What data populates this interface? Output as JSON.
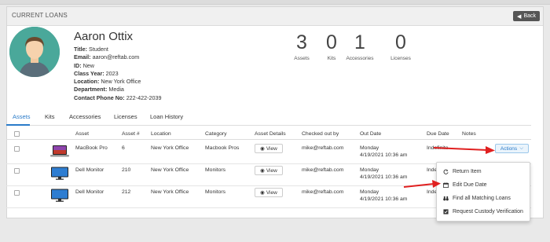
{
  "panel": {
    "title": "CURRENT LOANS",
    "back_label": "Back"
  },
  "profile": {
    "name": "Aaron Ottix",
    "fields": [
      {
        "label": "Title:",
        "value": "Student"
      },
      {
        "label": "Email:",
        "value": "aaron@reftab.com"
      },
      {
        "label": "ID:",
        "value": "New"
      },
      {
        "label": "Class Year:",
        "value": "2023"
      },
      {
        "label": "Location:",
        "value": "New York Office"
      },
      {
        "label": "Department:",
        "value": "Media"
      },
      {
        "label": "Contact Phone No:",
        "value": "222-422-2039"
      }
    ]
  },
  "stats": [
    {
      "value": "3",
      "label": "Assets"
    },
    {
      "value": "0",
      "label": "Kits"
    },
    {
      "value": "1",
      "label": "Accessories"
    },
    {
      "value": "0",
      "label": "Licenses"
    }
  ],
  "tabs": [
    "Assets",
    "Kits",
    "Accessories",
    "Licenses",
    "Loan History"
  ],
  "table": {
    "headers": [
      "Asset",
      "Asset #",
      "Location",
      "Category",
      "Asset Details",
      "Checked out by",
      "Out Date",
      "Due Date",
      "Notes"
    ],
    "view_label": "View",
    "actions_label": "Actions",
    "rows": [
      {
        "asset": "MacBook Pro",
        "asset_no": "6",
        "location": "New York Office",
        "category": "Macbook Pros",
        "checked_out_by": "mike@reftab.com",
        "out_day": "Monday",
        "out_time": "4/19/2021 10:36 am",
        "due": "Indefinite"
      },
      {
        "asset": "Dell Monitor",
        "asset_no": "210",
        "location": "New York Office",
        "category": "Monitors",
        "checked_out_by": "mike@reftab.com",
        "out_day": "Monday",
        "out_time": "4/19/2021 10:36 am",
        "due": "Inde"
      },
      {
        "asset": "Dell Monitor",
        "asset_no": "212",
        "location": "New York Office",
        "category": "Monitors",
        "checked_out_by": "mike@reftab.com",
        "out_day": "Monday",
        "out_time": "4/19/2021 10:36 am",
        "due": "Inde"
      }
    ]
  },
  "dropdown": {
    "items": [
      "Return Item",
      "Edit Due Date",
      "Find all Matching Loans",
      "Request Custody Verification"
    ]
  },
  "colors": {
    "accent": "#2a7bc9",
    "arrow": "#e02020",
    "avatar_bg": "#4aa89a"
  }
}
